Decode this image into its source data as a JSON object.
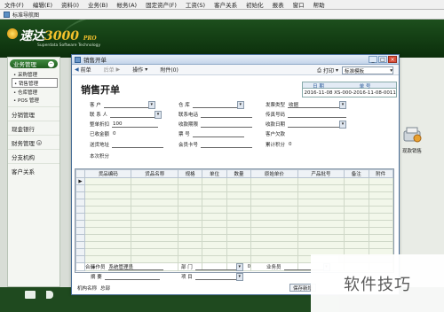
{
  "menubar": {
    "items": [
      "文件(F)",
      "编辑(E)",
      "资料(I)",
      "业务(B)",
      "帐务(A)",
      "固定资产(F)",
      "工资(S)",
      "客户关系",
      "初始化",
      "报表",
      "窗口",
      "帮助"
    ]
  },
  "toolbar2": {
    "label": "标准导航图"
  },
  "header": {
    "brand_cn": "速达",
    "brand_num": "3000",
    "brand_sub": "PRO",
    "tagline": "Superdata Software Technology"
  },
  "sidebar": {
    "head_label": "业务管理",
    "sub_items": [
      "采购管理",
      "销售管理",
      "仓库管理",
      "POS 管理"
    ],
    "selected_index": 1,
    "items": [
      "分销管理",
      "现金银行",
      "财务管理",
      "分支机构",
      "客户关系"
    ]
  },
  "right_panel": {
    "label": "现款销售"
  },
  "window": {
    "title": "销售开单",
    "controls": {
      "min": "_",
      "max": "□",
      "close": "×"
    },
    "toolbar": {
      "prev": "前单",
      "next": "后单",
      "ops": "操作",
      "attach": "附件(0)",
      "print": "打印",
      "template": "标准模板"
    },
    "form": {
      "title": "销售开单",
      "date_header": "日 期",
      "number_header": "单 号",
      "date_value": "2016-11-08",
      "number_value": "XS-000-2016-11-08-0011",
      "fields": {
        "customer": "客 户",
        "warehouse": "仓 库",
        "invoice_type": "发票类型",
        "invoice_type_value": "收据",
        "contact": "联 系 人",
        "contact_phone": "联系电话",
        "fax": "传真号码",
        "discount": "整单折扣",
        "discount_value": "100",
        "receive_term": "收款期限",
        "receive_date": "收款日期",
        "received_amount": "已收金额",
        "received_amount_value": "0",
        "ticket_no": "票 号",
        "customer_debt": "客户欠款",
        "delivery_address": "送货地址",
        "member_card": "会员卡号",
        "accum_points": "累计积分",
        "accum_points_value": "0",
        "current_points": "本次积分"
      }
    },
    "grid": {
      "columns": [
        "货品编码",
        "货品名称",
        "规格",
        "单位",
        "数量",
        "原始单价",
        "产品批号",
        "备注",
        "附件"
      ],
      "sum_label": "合计",
      "sum_value": "0"
    },
    "footer": {
      "operator_label": "操作员",
      "operator_value": "系统管理员",
      "department_label": "部 门",
      "salesperson_label": "业务员",
      "summary_label": "摘 要",
      "project_label": "项 目",
      "branch_label": "机构名称",
      "branch_value": "总部",
      "save_button": "保存新增"
    }
  },
  "watermark": "软件技巧"
}
